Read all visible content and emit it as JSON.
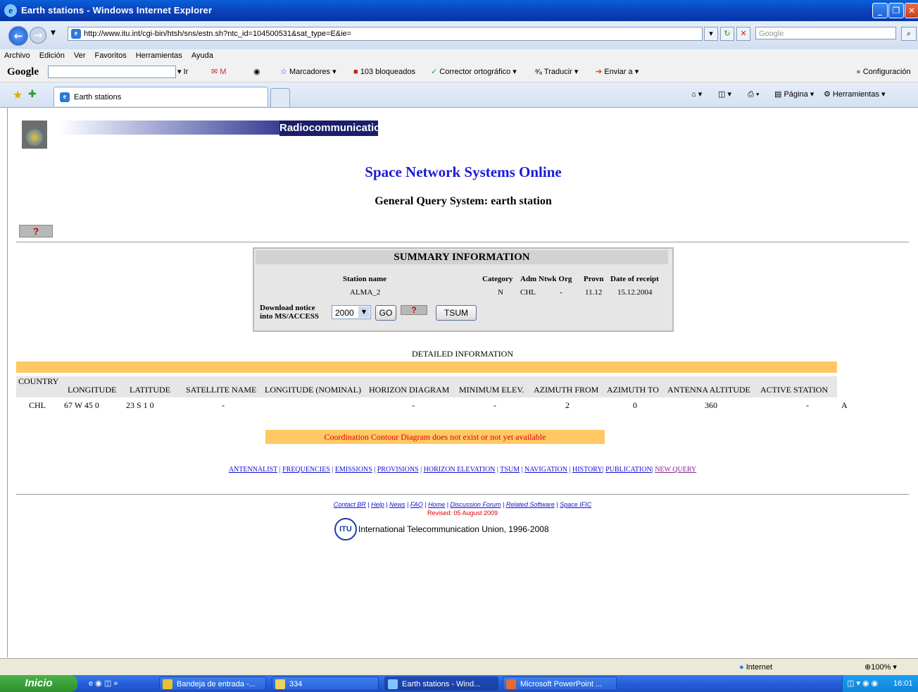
{
  "window": {
    "title": "Earth stations - Windows Internet Explorer"
  },
  "address": {
    "url": "http://www.itu.int/cgi-bin/htsh/sns/estn.sh?ntc_id=104500531&sat_type=E&ie=",
    "search_placeholder": "Google"
  },
  "menu": [
    "Archivo",
    "Edición",
    "Ver",
    "Favoritos",
    "Herramientas",
    "Ayuda"
  ],
  "google_toolbar": {
    "logo": "Google",
    "go_label": "Ir",
    "bookmarks": "Marcadores",
    "blocked": "103 bloqueados",
    "spell": "Corrector ortográfico",
    "translate": "Traducir",
    "send": "Enviar a",
    "settings": "Configuración"
  },
  "tabs": {
    "active": "Earth stations",
    "page_menu": "Página",
    "tools_menu": "Herramientas"
  },
  "page": {
    "banner_label": "Radiocommunication",
    "title": "Space Network Systems Online",
    "subtitle": "General Query System: earth station",
    "help_mark": "?",
    "summary": {
      "title": "SUMMARY INFORMATION",
      "headers": {
        "station": "Station name",
        "category": "Category",
        "adm": "Adm",
        "ntwk": "Ntwk Org",
        "provn": "Provn",
        "date": "Date of receipt"
      },
      "values": {
        "station": "ALMA_2",
        "category": "N",
        "adm": "CHL",
        "ntwk": "-",
        "provn": "11.12",
        "date": "15.12.2004"
      },
      "download_label_1": "Download notice",
      "download_label_2": "into MS/ACCESS",
      "year": "2000",
      "go": "GO",
      "tsum": "TSUM"
    },
    "detail": {
      "title": "DETAILED INFORMATION",
      "headers": [
        "COUNTRY",
        "LONGITUDE",
        "LATITUDE",
        "SATELLITE NAME",
        "LONGITUDE (NOMINAL)",
        "HORIZON DIAGRAM",
        "MINIMUM ELEV.",
        "AZIMUTH FROM",
        "AZIMUTH TO",
        "ANTENNA ALTITUDE",
        "ACTIVE STATION"
      ],
      "row": [
        "CHL",
        "67 W 45 0",
        "23 S 1 0",
        "-",
        "-",
        "-",
        "2",
        "0",
        "360",
        "-",
        "A"
      ]
    },
    "coordination_notice": "Coordination Contour Diagram does not exist or not yet available",
    "nav_links": [
      "ANTENNALIST",
      "FREQUENCIES",
      "EMISSIONS",
      "PROVISIONS",
      "HORIZON ELEVATION",
      "TSUM",
      "NAVIGATION",
      "HISTORY",
      "PUBLICATION",
      "NEW QUERY"
    ],
    "footer_links": [
      "Contact BR",
      "Help",
      "News",
      "FAQ",
      "Home",
      "Discussion Forum",
      "Related Software",
      "Space IFIC"
    ],
    "revised": "Revised: 05 August 2009",
    "itu_logo": "ITU",
    "copyright": "International Telecommunication Union, 1996-2008"
  },
  "status": {
    "zone": "Internet",
    "zoom": "100%"
  },
  "taskbar": {
    "start": "Inicio",
    "tasks": [
      "Bandeja de entrada -...",
      "334",
      "Earth stations - Wind...",
      "Microsoft PowerPoint ..."
    ],
    "clock": "16:01"
  },
  "colors": {
    "title_blue": "#1b1bd8",
    "highlight_orange": "#ffc864",
    "alert_red": "#e00000",
    "itu_navy": "#1b1e6a"
  }
}
